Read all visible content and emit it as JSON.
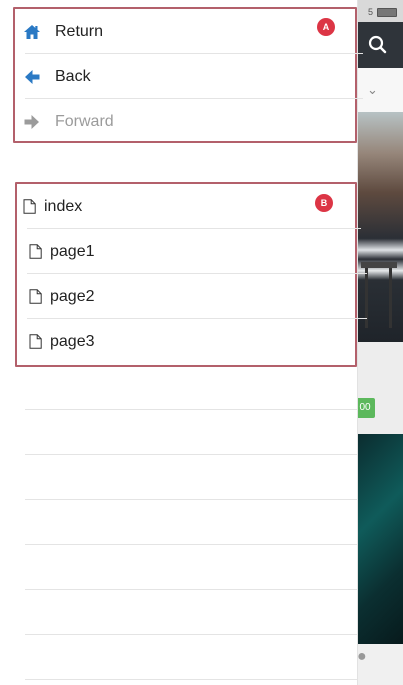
{
  "colors": {
    "accent": "#2a79c4",
    "annotation_border": "#b3606b",
    "badge": "#dc3545",
    "disabled_text": "#9b9b9b",
    "divider": "#e4e4e4"
  },
  "nav_group": {
    "badge": "A",
    "items": [
      {
        "label": "Return",
        "icon": "home-icon",
        "state": "enabled"
      },
      {
        "label": "Back",
        "icon": "arrow-left-icon",
        "state": "enabled"
      },
      {
        "label": "Forward",
        "icon": "arrow-right-icon",
        "state": "disabled"
      }
    ]
  },
  "pages_group": {
    "badge": "B",
    "items": [
      {
        "label": "index",
        "icon": "file-icon"
      },
      {
        "label": "page1",
        "icon": "file-icon"
      },
      {
        "label": "page2",
        "icon": "file-icon"
      },
      {
        "label": "page3",
        "icon": "file-icon"
      }
    ]
  },
  "background_app": {
    "price_button_text": "00"
  }
}
